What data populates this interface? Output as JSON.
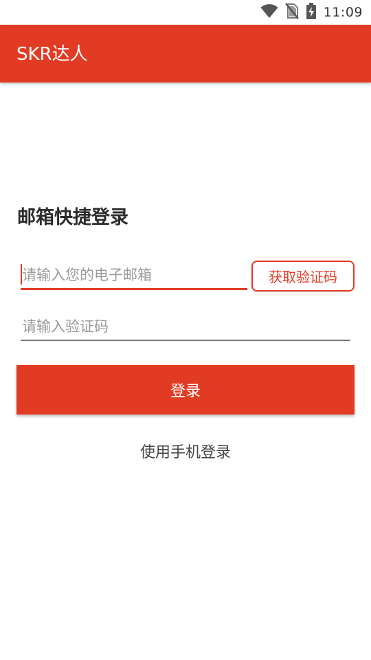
{
  "status_bar": {
    "time": "11:09",
    "icons": [
      "wifi-icon",
      "no-sim-icon",
      "battery-charging-icon"
    ]
  },
  "app_bar": {
    "title": "SKR达人"
  },
  "login_form": {
    "title": "邮箱快捷登录",
    "email_placeholder": "请输入您的电子邮箱",
    "email_value": "",
    "get_code_label": "获取验证码",
    "code_placeholder": "请输入验证码",
    "code_value": "",
    "login_label": "登录",
    "phone_login_label": "使用手机登录"
  },
  "colors": {
    "accent": "#e23b24",
    "background": "#ffffff",
    "text_dark": "#2b2b2b",
    "placeholder": "#9a9a9a"
  }
}
